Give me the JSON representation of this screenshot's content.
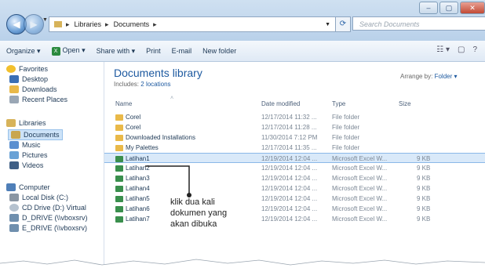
{
  "window": {
    "buttons": [
      "–",
      "▢",
      "✕"
    ]
  },
  "address": {
    "crumbs": [
      "Libraries",
      "Documents"
    ],
    "search_placeholder": "Search Documents"
  },
  "toolbar": {
    "organize": "Organize ▾",
    "open": "Open ▾",
    "share_with": "Share with ▾",
    "print": "Print",
    "email": "E-mail",
    "new_folder": "New folder"
  },
  "sidebar": {
    "favorites": "Favorites",
    "desktop": "Desktop",
    "downloads": "Downloads",
    "recent_places": "Recent Places",
    "libraries": "Libraries",
    "documents": "Documents",
    "music": "Music",
    "pictures": "Pictures",
    "videos": "Videos",
    "computer": "Computer",
    "local_disk": "Local Disk (C:)",
    "cd_drive": "CD Drive (D:) Virtual",
    "d_drive": "D_DRIVE (\\\\vboxsrv)",
    "e_drive": "E_DRIVE (\\\\vboxsrv)"
  },
  "library": {
    "title": "Documents library",
    "includes_label": "Includes:",
    "locations_link": "2 locations",
    "arrange_label": "Arrange by:",
    "arrange_value": "Folder ▾"
  },
  "columns": {
    "name": "Name",
    "date_modified": "Date modified",
    "type": "Type",
    "size": "Size"
  },
  "files": [
    {
      "name": "Corel",
      "date": "12/17/2014 11:32 ...",
      "type": "File folder",
      "size": "",
      "kind": "folder"
    },
    {
      "name": "Corel",
      "date": "12/17/2014 11:28 ...",
      "type": "File folder",
      "size": "",
      "kind": "folder"
    },
    {
      "name": "Downloaded Installations",
      "date": "11/30/2014 7:12 PM",
      "type": "File folder",
      "size": "",
      "kind": "folder"
    },
    {
      "name": "My Palettes",
      "date": "12/17/2014 11:35 ...",
      "type": "File folder",
      "size": "",
      "kind": "folder"
    },
    {
      "name": "Latihan1",
      "date": "12/19/2014 12:04 ...",
      "type": "Microsoft Excel W...",
      "size": "9 KB",
      "kind": "excel"
    },
    {
      "name": "Latihan2",
      "date": "12/19/2014 12:04 ...",
      "type": "Microsoft Excel W...",
      "size": "9 KB",
      "kind": "excel"
    },
    {
      "name": "Latihan3",
      "date": "12/19/2014 12:04 ...",
      "type": "Microsoft Excel W...",
      "size": "9 KB",
      "kind": "excel"
    },
    {
      "name": "Latihan4",
      "date": "12/19/2014 12:04 ...",
      "type": "Microsoft Excel W...",
      "size": "9 KB",
      "kind": "excel"
    },
    {
      "name": "Latihan5",
      "date": "12/19/2014 12:04 ...",
      "type": "Microsoft Excel W...",
      "size": "9 KB",
      "kind": "excel"
    },
    {
      "name": "Latihan6",
      "date": "12/19/2014 12:04 ...",
      "type": "Microsoft Excel W...",
      "size": "9 KB",
      "kind": "excel"
    },
    {
      "name": "Latihan7",
      "date": "12/19/2014 12:04 ...",
      "type": "Microsoft Excel W...",
      "size": "9 KB",
      "kind": "excel"
    }
  ],
  "annotation": {
    "line1": "klik dua kali",
    "line2": "dokumen yang",
    "line3": "akan dibuka"
  }
}
